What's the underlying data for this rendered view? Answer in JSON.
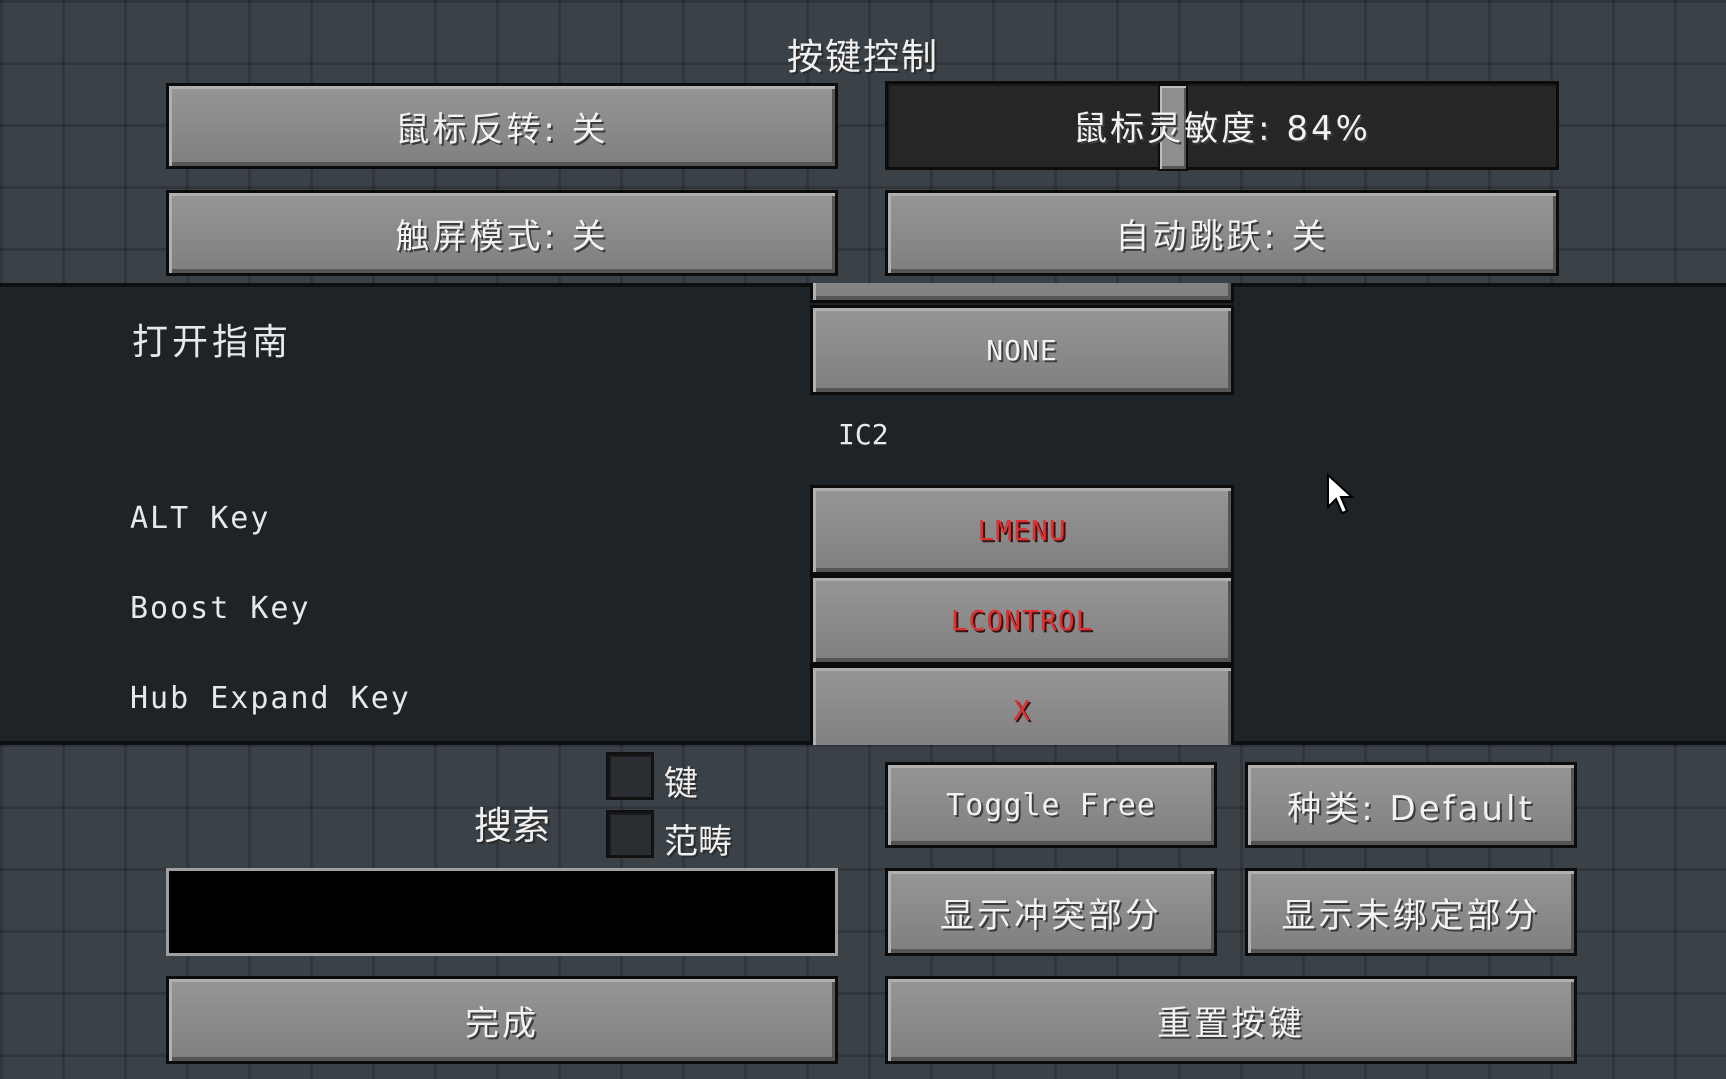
{
  "title": "按键控制",
  "options": {
    "invert_mouse": "鼠标反转: 关",
    "sensitivity": "鼠标灵敏度: 84%",
    "sensitivity_value": 0.84,
    "touchscreen": "触屏模式: 关",
    "auto_jump": "自动跳跃: 关"
  },
  "list": {
    "rows": [
      {
        "label": "打开指南",
        "key": "NONE"
      },
      {
        "category": "IC2"
      },
      {
        "label": "ALT Key",
        "key": "LMENU"
      },
      {
        "label": "Boost Key",
        "key": "LCONTROL"
      },
      {
        "label": "Hub Expand Key",
        "key": "X"
      }
    ]
  },
  "search": {
    "label": "搜索",
    "checkbox_key": "键",
    "checkbox_category": "范畴",
    "value": ""
  },
  "buttons": {
    "toggle_free": "Toggle Free",
    "category": "种类: Default",
    "show_conflicts": "显示冲突部分",
    "show_unbound": "显示未绑定部分",
    "done": "完成",
    "reset": "重置按键"
  },
  "colors": {
    "conflict": "#e03030",
    "button": "#8a8a8a",
    "panel": "#1e2328"
  }
}
